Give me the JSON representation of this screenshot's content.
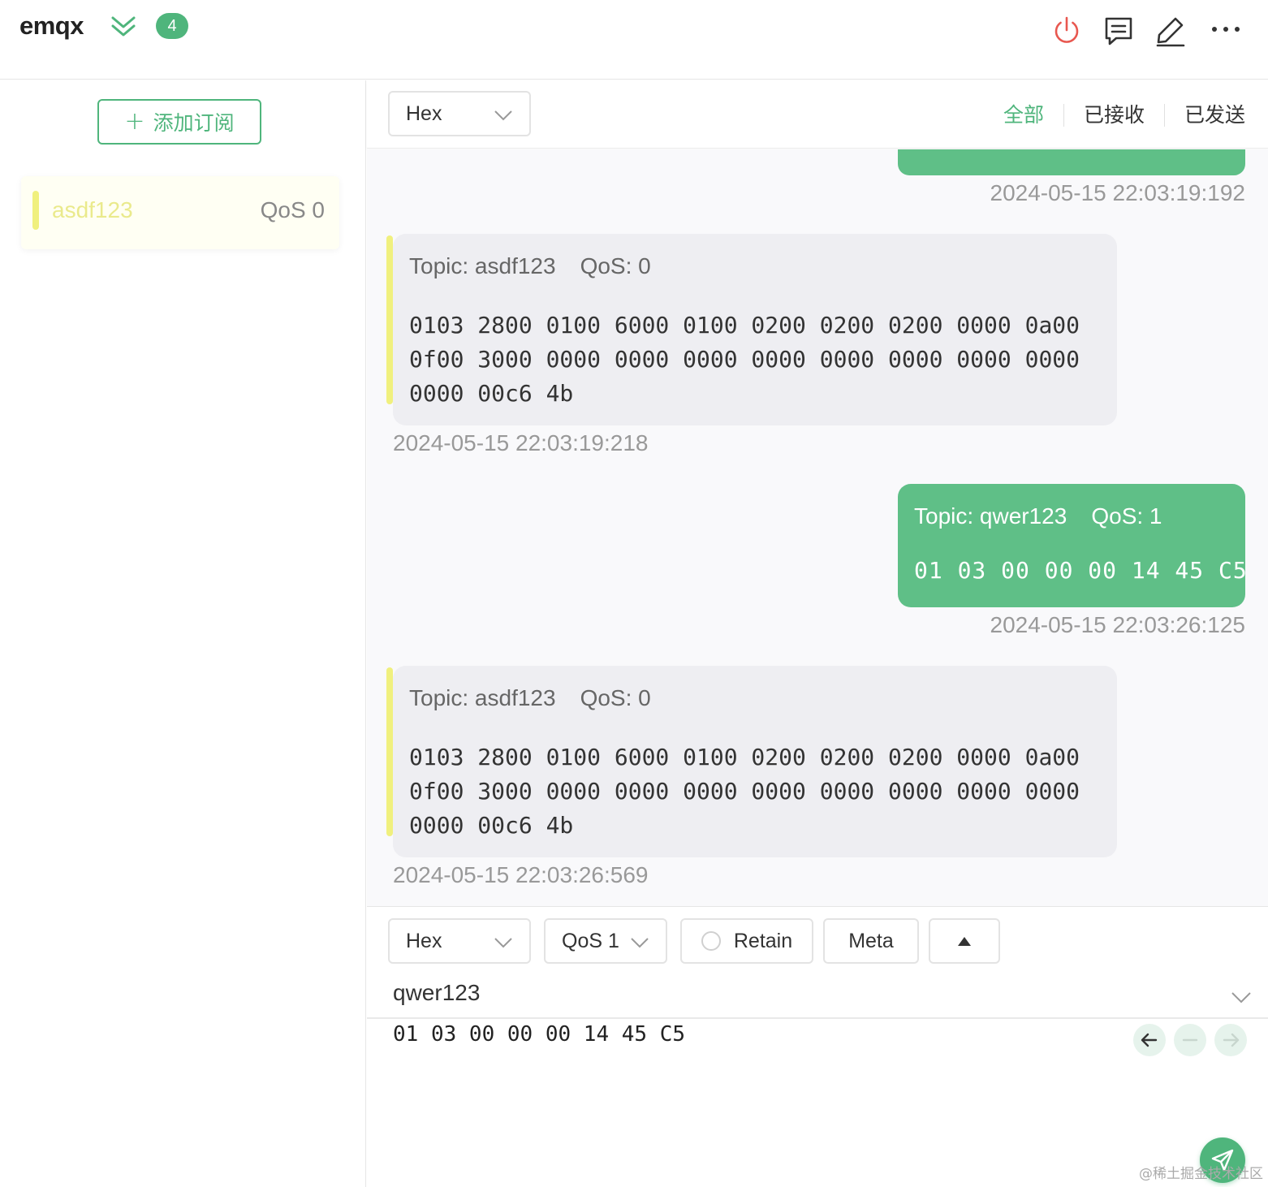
{
  "header": {
    "connection_name": "emqx",
    "message_count": "4",
    "icons": [
      "double-chevron-down-icon",
      "power-icon",
      "message-icon",
      "edit-icon",
      "more-icon"
    ],
    "colors": {
      "power": "#e8574f",
      "accent": "#4fb57c"
    }
  },
  "sidebar": {
    "add_subscription_label": "添加订阅",
    "subscriptions": [
      {
        "topic": "asdf123",
        "qos": "QoS 0",
        "color": "#f0f07e"
      }
    ]
  },
  "toolbar": {
    "format_select": "Hex",
    "tabs": [
      {
        "label": "全部",
        "active": true
      },
      {
        "label": "已接收",
        "active": false
      },
      {
        "label": "已发送",
        "active": false
      }
    ]
  },
  "messages": [
    {
      "direction": "sent",
      "partial": true,
      "time": "2024-05-15 22:03:19:192"
    },
    {
      "direction": "received",
      "topic": "Topic: asdf123",
      "qos": "QoS: 0",
      "payload": "0103 2800 0100 6000 0100 0200 0200 0200 0000 0a00\n0f00 3000 0000 0000 0000 0000 0000 0000 0000 0000\n0000 00c6 4b",
      "time": "2024-05-15 22:03:19:218"
    },
    {
      "direction": "sent",
      "topic": "Topic: qwer123",
      "qos": "QoS: 1",
      "payload": "01 03 00 00 00 14 45 C5",
      "time": "2024-05-15 22:03:26:125"
    },
    {
      "direction": "received",
      "topic": "Topic: asdf123",
      "qos": "QoS: 0",
      "payload": "0103 2800 0100 6000 0100 0200 0200 0200 0000 0a00\n0f00 3000 0000 0000 0000 0000 0000 0000 0000 0000\n0000 00c6 4b",
      "time": "2024-05-15 22:03:26:569"
    }
  ],
  "publish": {
    "format_select": "Hex",
    "qos_select": "QoS 1",
    "retain_label": "Retain",
    "meta_label": "Meta",
    "topic": "qwer123",
    "payload": "01 03 00 00 00 14 45 C5"
  },
  "watermark": "@稀土掘金技术社区"
}
